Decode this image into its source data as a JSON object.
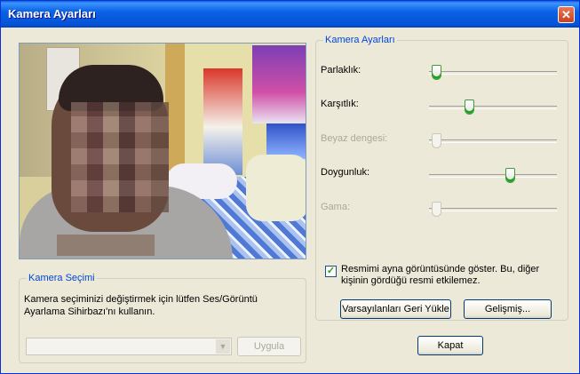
{
  "window": {
    "title": "Kamera Ayarları",
    "close_symbol": "✕"
  },
  "camera_selection": {
    "legend": "Kamera Seçimi",
    "description": "Kamera seçiminizi değiştirmek için lütfen Ses/Görüntü Ayarlama Sihirbazı'nı kullanın.",
    "dropdown_value": "",
    "apply_label": "Uygula"
  },
  "camera_settings": {
    "legend": "Kamera Ayarları",
    "sliders": [
      {
        "label": "Parlaklık:",
        "value_fraction": 0.02,
        "enabled": true
      },
      {
        "label": "Karşıtlık:",
        "value_fraction": 0.3,
        "enabled": true
      },
      {
        "label": "Beyaz dengesi:",
        "value_fraction": 0.02,
        "enabled": false
      },
      {
        "label": "Doygunluk:",
        "value_fraction": 0.65,
        "enabled": true
      },
      {
        "label": "Gama:",
        "value_fraction": 0.02,
        "enabled": false
      }
    ],
    "mirror_checkbox": {
      "checked": true,
      "label": "Resmimi ayna görüntüsünde göster. Bu, diğer kişinin gördüğü resmi etkilemez."
    },
    "restore_defaults_label": "Varsayılanları Geri Yükle",
    "advanced_label": "Gelişmiş...",
    "checkmark": "✓"
  },
  "footer": {
    "close_label": "Kapat"
  },
  "colors": {
    "accent_title": "#0a5fd8",
    "legend_text": "#0046d5",
    "slider_thumb": "#21a121"
  },
  "icons": {
    "close": "close-icon",
    "dropdown": "chevron-down-icon",
    "check": "checkmark-icon"
  }
}
